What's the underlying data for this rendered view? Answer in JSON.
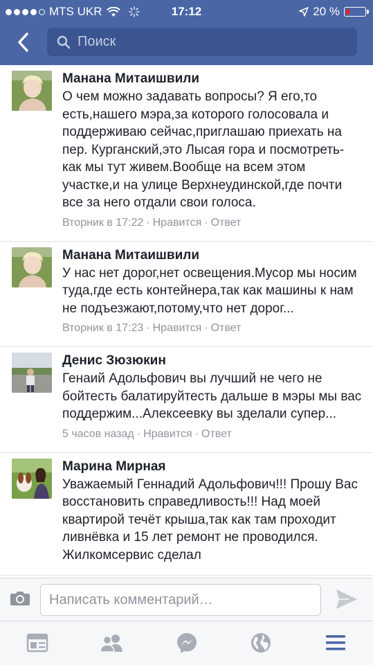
{
  "status_bar": {
    "carrier": "MTS UKR",
    "time": "17:12",
    "battery": "20 %",
    "battery_level": 0.2
  },
  "nav": {
    "search_placeholder": "Поиск"
  },
  "comments": [
    {
      "author": "Манана Митаишвили",
      "text": "О чем можно задавать вопросы? Я его,то есть,нашего мэра,за которого голосовала и поддерживаю сейчас,приглашаю приехать на пер. Курганский,это Лысая гора и посмотреть-как мы тут живем.Вообще на всем этом участке,и на улице Верхнеудинской,где почти все за него отдали свои голоса.",
      "time": "Вторник в 17:22",
      "like": "Нравится",
      "reply": "Ответ"
    },
    {
      "author": "Манана Митаишвили",
      "text": "У нас нет дорог,нет освещения.Мусор мы носим туда,где есть контейнера,так как машины к нам не подъезжают,потому,что нет дорог...",
      "time": "Вторник в 17:23",
      "like": "Нравится",
      "reply": "Ответ"
    },
    {
      "author": "Денис Зюзюкин",
      "text": "Генаий Адольфович вы лучший не чего не бойтесть балатируйтесть дальше в мэры мы вас поддержим...Алексеевку вы зделали супер...",
      "time": "5 часов назад",
      "like": "Нравится",
      "reply": "Ответ"
    },
    {
      "author": "Марина Мирная",
      "text": "Уважаемый Геннадий Адольфович!!! Прошу Вас восстановить справедливость!!! Над моей квартирой течёт крыша,так как там проходит ливнёвка и 15 лет ремонт не проводился. Жилкомсервис сделал",
      "time": "",
      "like": "",
      "reply": ""
    }
  ],
  "composer": {
    "placeholder": "Написать комментарий…"
  },
  "colors": {
    "brand": "#4a66a5",
    "search_bg": "#3a5590",
    "meta_text": "#90949c",
    "tab_active": "#4a66a5",
    "tab_inactive": "#a8adb8"
  },
  "tabs": [
    {
      "icon": "news-feed-icon",
      "active": false
    },
    {
      "icon": "friends-icon",
      "active": false
    },
    {
      "icon": "messenger-icon",
      "active": false
    },
    {
      "icon": "globe-notifications-icon",
      "active": false
    },
    {
      "icon": "menu-icon",
      "active": true
    }
  ]
}
